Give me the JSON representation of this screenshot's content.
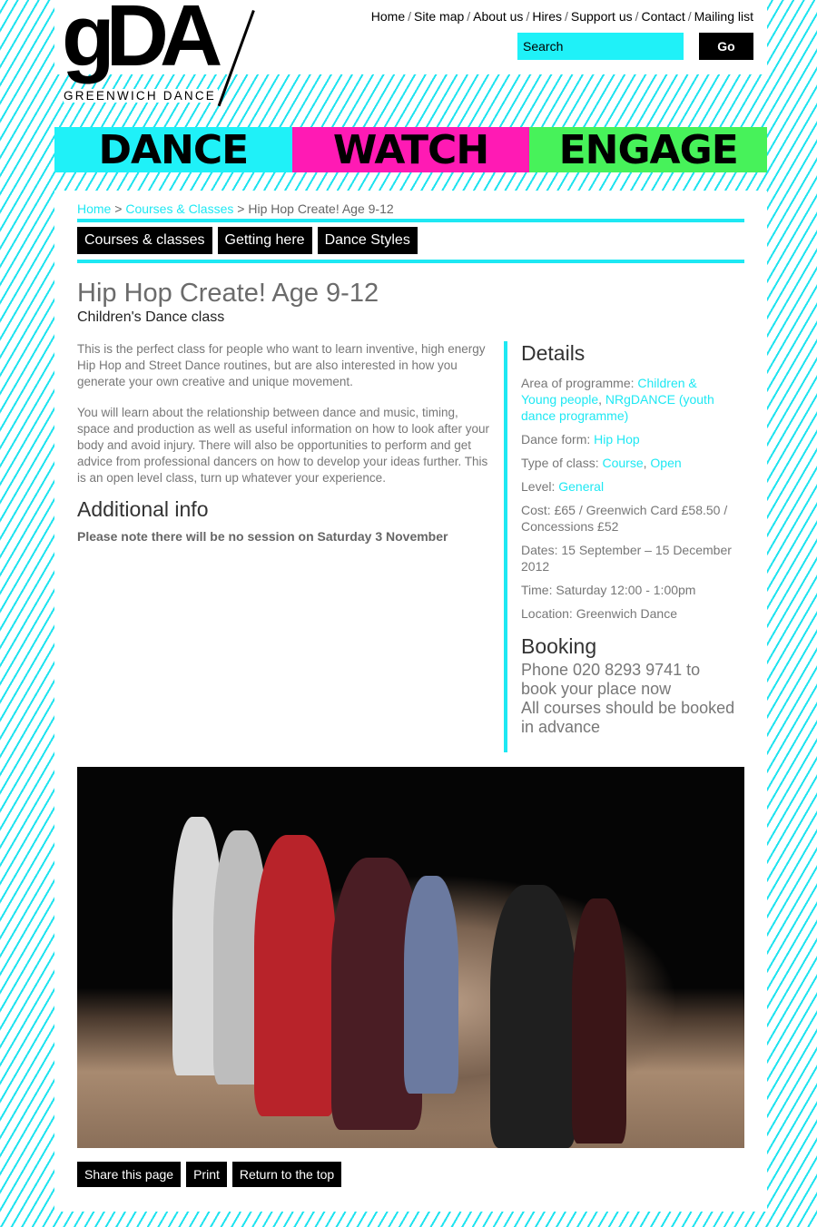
{
  "logo": {
    "letters": "gDA",
    "subtitle": "GREENWICH DANCE"
  },
  "topnav": [
    "Home",
    "Site map",
    "About us",
    "Hires",
    "Support us",
    "Contact",
    "Mailing list"
  ],
  "search": {
    "placeholder": "Search",
    "go_label": "Go"
  },
  "mainnav": [
    {
      "label": "DANCE",
      "color": "#1ff1f8"
    },
    {
      "label": "WATCH",
      "color": "#ff1ab4"
    },
    {
      "label": "ENGAGE",
      "color": "#47f25a"
    }
  ],
  "breadcrumb": {
    "home": "Home",
    "courses": "Courses & Classes",
    "current": "Hip Hop Create! Age 9-12"
  },
  "subnav": [
    "Courses & classes",
    "Getting here",
    "Dance Styles"
  ],
  "page": {
    "title": "Hip Hop Create! Age 9-12",
    "subtitle": "Children's Dance class",
    "paragraph1": "This is the perfect class for people who want to learn inventive, high energy Hip Hop and Street Dance routines, but are also interested in how you generate your own creative and unique movement.",
    "paragraph2": "You will learn about the relationship between dance and music, timing, space and production as well as useful information on how to look after your body and avoid injury. There will also be opportunities to perform and get advice from professional dancers on how to develop your ideas further. This is an open level class, turn up whatever your experience.",
    "additional_title": "Additional info",
    "additional_note": "Please note there will be no session on Saturday 3 November"
  },
  "details": {
    "title": "Details",
    "area_label": "Area of programme:",
    "area_link1": "Children & Young people",
    "area_link2": "NRgDANCE (youth dance programme)",
    "form_label": "Dance form:",
    "form_link": "Hip Hop",
    "type_label": "Type of class:",
    "type_link1": "Course",
    "type_link2": "Open",
    "level_label": "Level:",
    "level_link": "General",
    "cost": "Cost: £65 / Greenwich Card £58.50 / Concessions £52",
    "dates": "Dates: 15 September – 15 December 2012",
    "time": "Time: Saturday 12:00 - 1:00pm",
    "location": "Location: Greenwich Dance",
    "booking_title": "Booking",
    "booking_phone": "Phone 020 8293 9741 to book your place now",
    "booking_note": "All courses should be booked in advance"
  },
  "footer": [
    "Share this page",
    "Print",
    "Return to the top"
  ]
}
